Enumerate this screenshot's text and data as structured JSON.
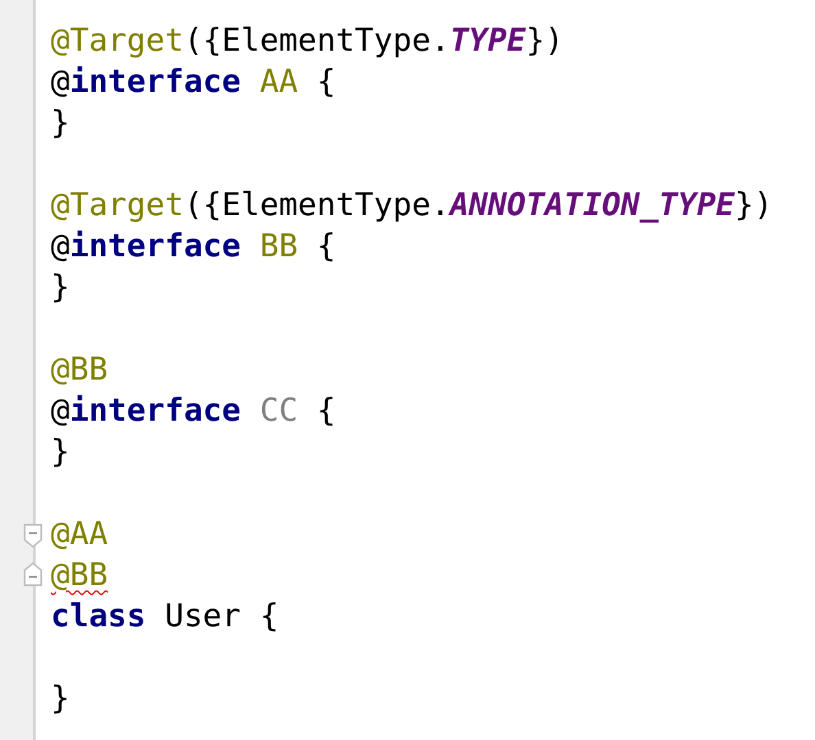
{
  "editor": {
    "blocks": [
      {
        "lines": [
          {
            "tokens": [
              {
                "text": "@Target",
                "kind": "annotation"
              },
              {
                "text": "({ElementType.",
                "kind": "plain"
              },
              {
                "text": "TYPE",
                "kind": "constant"
              },
              {
                "text": "})",
                "kind": "plain"
              }
            ]
          },
          {
            "tokens": [
              {
                "text": "@",
                "kind": "plain"
              },
              {
                "text": "interface ",
                "kind": "keyword"
              },
              {
                "text": "AA",
                "kind": "annotation"
              },
              {
                "text": " {",
                "kind": "plain"
              }
            ]
          },
          {
            "tokens": [
              {
                "text": "}",
                "kind": "plain"
              }
            ]
          }
        ]
      },
      {
        "lines": [
          {
            "tokens": [
              {
                "text": "@Target",
                "kind": "annotation"
              },
              {
                "text": "({ElementType.",
                "kind": "plain"
              },
              {
                "text": "ANNOTATION_TYPE",
                "kind": "constant"
              },
              {
                "text": "})",
                "kind": "plain"
              }
            ]
          },
          {
            "tokens": [
              {
                "text": "@",
                "kind": "plain"
              },
              {
                "text": "interface ",
                "kind": "keyword"
              },
              {
                "text": "BB",
                "kind": "annotation"
              },
              {
                "text": " {",
                "kind": "plain"
              }
            ]
          },
          {
            "tokens": [
              {
                "text": "}",
                "kind": "plain"
              }
            ]
          }
        ]
      },
      {
        "lines": [
          {
            "tokens": [
              {
                "text": "@BB",
                "kind": "annotation"
              }
            ]
          },
          {
            "tokens": [
              {
                "text": "@",
                "kind": "plain"
              },
              {
                "text": "interface ",
                "kind": "keyword"
              },
              {
                "text": "CC",
                "kind": "unused"
              },
              {
                "text": " {",
                "kind": "plain"
              }
            ]
          },
          {
            "tokens": [
              {
                "text": "}",
                "kind": "plain"
              }
            ]
          }
        ]
      },
      {
        "lines": [
          {
            "fold_start": true,
            "tokens": [
              {
                "text": "@AA",
                "kind": "annotation"
              }
            ]
          },
          {
            "fold_end": true,
            "tokens": [
              {
                "text": "@BB",
                "kind": "annotation",
                "error": true
              }
            ]
          },
          {
            "tokens": [
              {
                "text": "class",
                "kind": "keyword"
              },
              {
                "text": " User {",
                "kind": "plain"
              }
            ]
          }
        ]
      },
      {
        "lines": [
          {
            "tokens": [
              {
                "text": "}",
                "kind": "plain"
              }
            ]
          }
        ]
      }
    ]
  }
}
